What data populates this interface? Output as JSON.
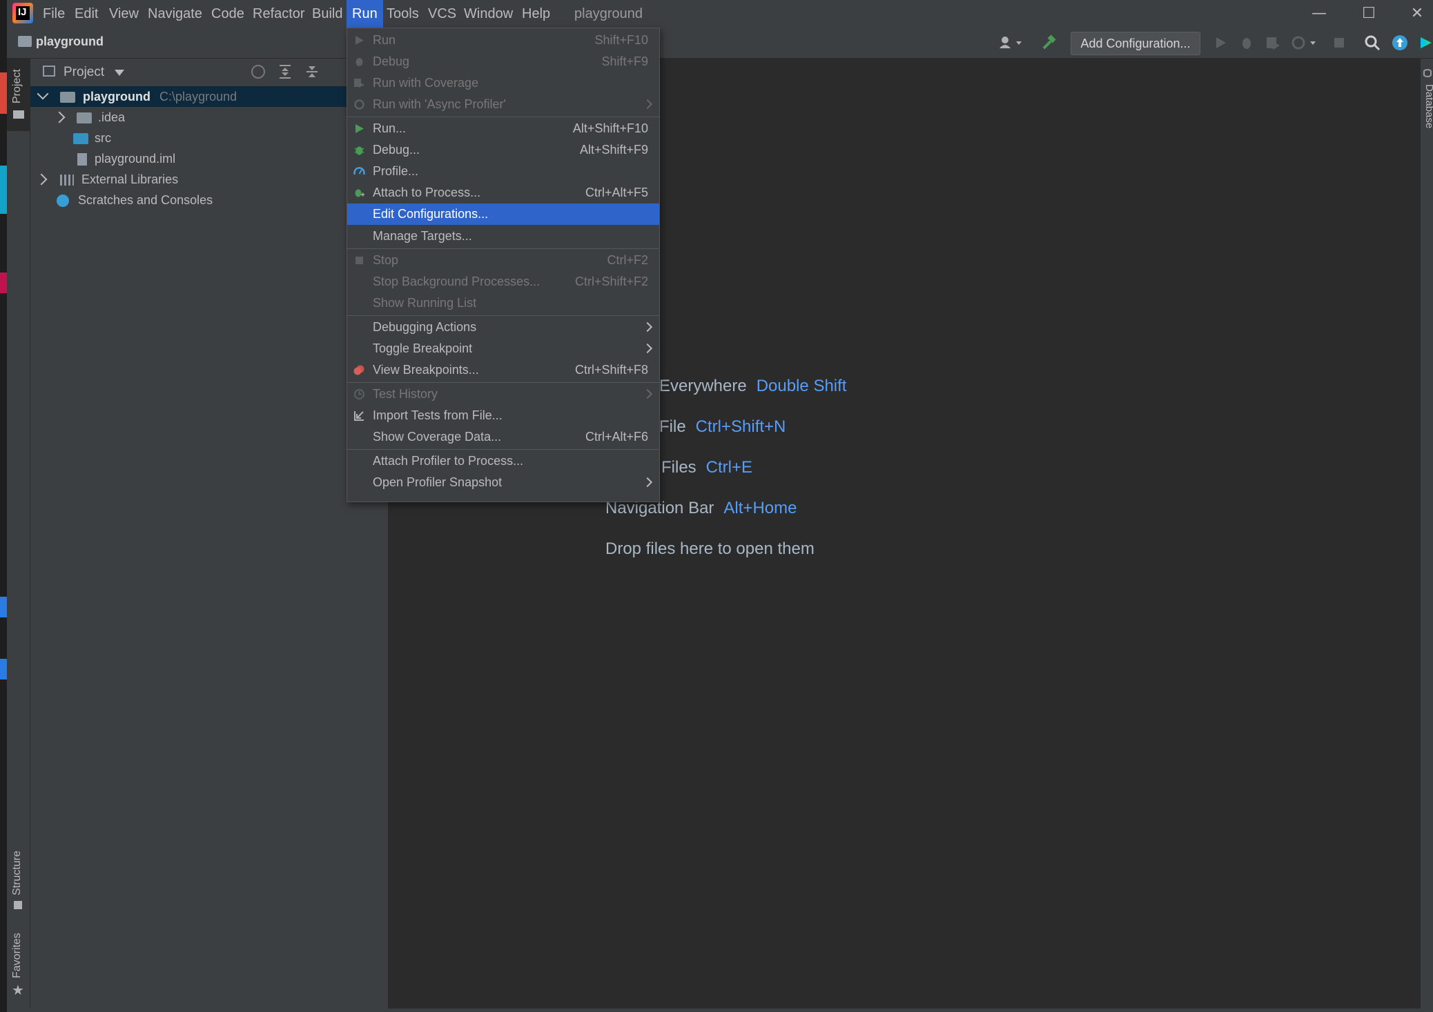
{
  "app": {
    "logo_text": "IJ",
    "window_title": "playground",
    "menus": [
      "File",
      "Edit",
      "View",
      "Navigate",
      "Code",
      "Refactor",
      "Build",
      "Run",
      "Tools",
      "VCS",
      "Window",
      "Help"
    ],
    "active_menu": "Run"
  },
  "navbar": {
    "project_name": "playground",
    "add_configuration": "Add Configuration..."
  },
  "left_strip": {
    "project_tab": "Project",
    "structure_tab": "Structure",
    "favorites_tab": "Favorites"
  },
  "right_strip": {
    "database_tab": "Database"
  },
  "project_panel": {
    "header": "Project",
    "tree": [
      {
        "label": "playground",
        "hint": "C:\\playground",
        "expanded": true
      },
      {
        "label": ".idea"
      },
      {
        "label": "src"
      },
      {
        "label": "playground.iml"
      },
      {
        "label": "External Libraries"
      },
      {
        "label": "Scratches and Consoles"
      }
    ]
  },
  "editor_hints": [
    {
      "label": "Everywhere",
      "key": "Double Shift"
    },
    {
      "label": "File",
      "key": "Ctrl+Shift+N"
    },
    {
      "label": "Files",
      "key": "Ctrl+E"
    },
    {
      "label": "Navigation Bar",
      "key": "Alt+Home"
    },
    {
      "label": "Drop files here to open them",
      "key": ""
    }
  ],
  "run_menu": {
    "items": [
      {
        "label": "Run",
        "shortcut": "Shift+F10",
        "disabled": true
      },
      {
        "label": "Debug",
        "shortcut": "Shift+F9",
        "disabled": true
      },
      {
        "label": "Run with Coverage",
        "shortcut": "",
        "disabled": true
      },
      {
        "label": "Run with 'Async Profiler'",
        "shortcut": "",
        "disabled": true,
        "submenu": true
      },
      {
        "label": "Run...",
        "shortcut": "Alt+Shift+F10"
      },
      {
        "label": "Debug...",
        "shortcut": "Alt+Shift+F9"
      },
      {
        "label": "Profile...",
        "shortcut": ""
      },
      {
        "label": "Attach to Process...",
        "shortcut": "Ctrl+Alt+F5"
      },
      {
        "label": "Edit Configurations...",
        "shortcut": "",
        "highlighted": true
      },
      {
        "label": "Manage Targets...",
        "shortcut": ""
      },
      {
        "label": "Stop",
        "shortcut": "Ctrl+F2",
        "disabled": true
      },
      {
        "label": "Stop Background Processes...",
        "shortcut": "Ctrl+Shift+F2",
        "disabled": true
      },
      {
        "label": "Show Running List",
        "shortcut": "",
        "disabled": true
      },
      {
        "label": "Debugging Actions",
        "shortcut": "",
        "submenu": true
      },
      {
        "label": "Toggle Breakpoint",
        "shortcut": "",
        "submenu": true
      },
      {
        "label": "View Breakpoints...",
        "shortcut": "Ctrl+Shift+F8"
      },
      {
        "label": "Test History",
        "shortcut": "",
        "disabled": true,
        "submenu": true
      },
      {
        "label": "Import Tests from File...",
        "shortcut": ""
      },
      {
        "label": "Show Coverage Data...",
        "shortcut": "Ctrl+Alt+F6"
      },
      {
        "label": "Attach Profiler to Process...",
        "shortcut": ""
      },
      {
        "label": "Open Profiler Snapshot",
        "shortcut": "",
        "submenu": true
      }
    ]
  },
  "colors": {
    "accent": "#2f65ca",
    "link": "#589df6",
    "run_green": "#499c54",
    "breakpoint_red": "#c75450"
  }
}
